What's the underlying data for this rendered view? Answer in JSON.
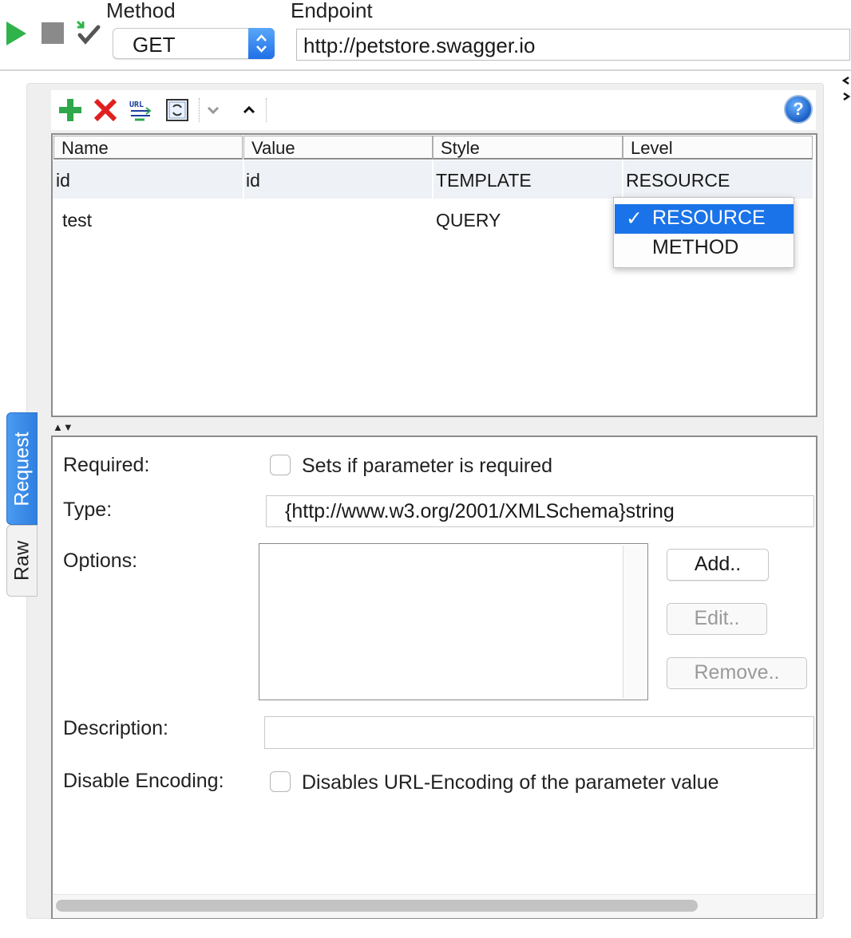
{
  "toolbar": {
    "run": "run-icon",
    "stop": "stop-icon",
    "submit": "submit-check-icon",
    "method_label": "Method",
    "method_value": "GET",
    "endpoint_label": "Endpoint",
    "endpoint_value": "http://petstore.swagger.io"
  },
  "param_toolbar": {
    "icons": [
      "add-param-icon",
      "remove-param-icon",
      "url-params-icon",
      "refresh-icon",
      "move-down-icon",
      "move-up-icon",
      "help-icon"
    ],
    "help_glyph": "?"
  },
  "table": {
    "columns": [
      "Name",
      "Value",
      "Style",
      "Level"
    ],
    "rows": [
      {
        "name": "id",
        "value": "id",
        "style": "TEMPLATE",
        "level": "RESOURCE"
      },
      {
        "name": "test",
        "value": "",
        "style": "QUERY",
        "level": ""
      }
    ]
  },
  "level_dropdown": {
    "check": "✓",
    "options": [
      "RESOURCE",
      "METHOD"
    ],
    "selected": "RESOURCE"
  },
  "splitter": "▲▼",
  "details": {
    "required_label": "Required:",
    "required_text": "Sets if parameter is required",
    "type_label": "Type:",
    "type_value": "{http://www.w3.org/2001/XMLSchema}string",
    "options_label": "Options:",
    "add_button": "Add..",
    "edit_button": "Edit..",
    "remove_button": "Remove..",
    "description_label": "Description:",
    "description_value": "",
    "disable_encoding_label": "Disable Encoding:",
    "disable_encoding_text": "Disables URL-Encoding of the parameter value"
  },
  "side_tabs": [
    "Request",
    "Raw"
  ],
  "colors": {
    "accent": "#1a73e8",
    "run_green": "#2fb34a",
    "remove_red": "#e02020"
  }
}
